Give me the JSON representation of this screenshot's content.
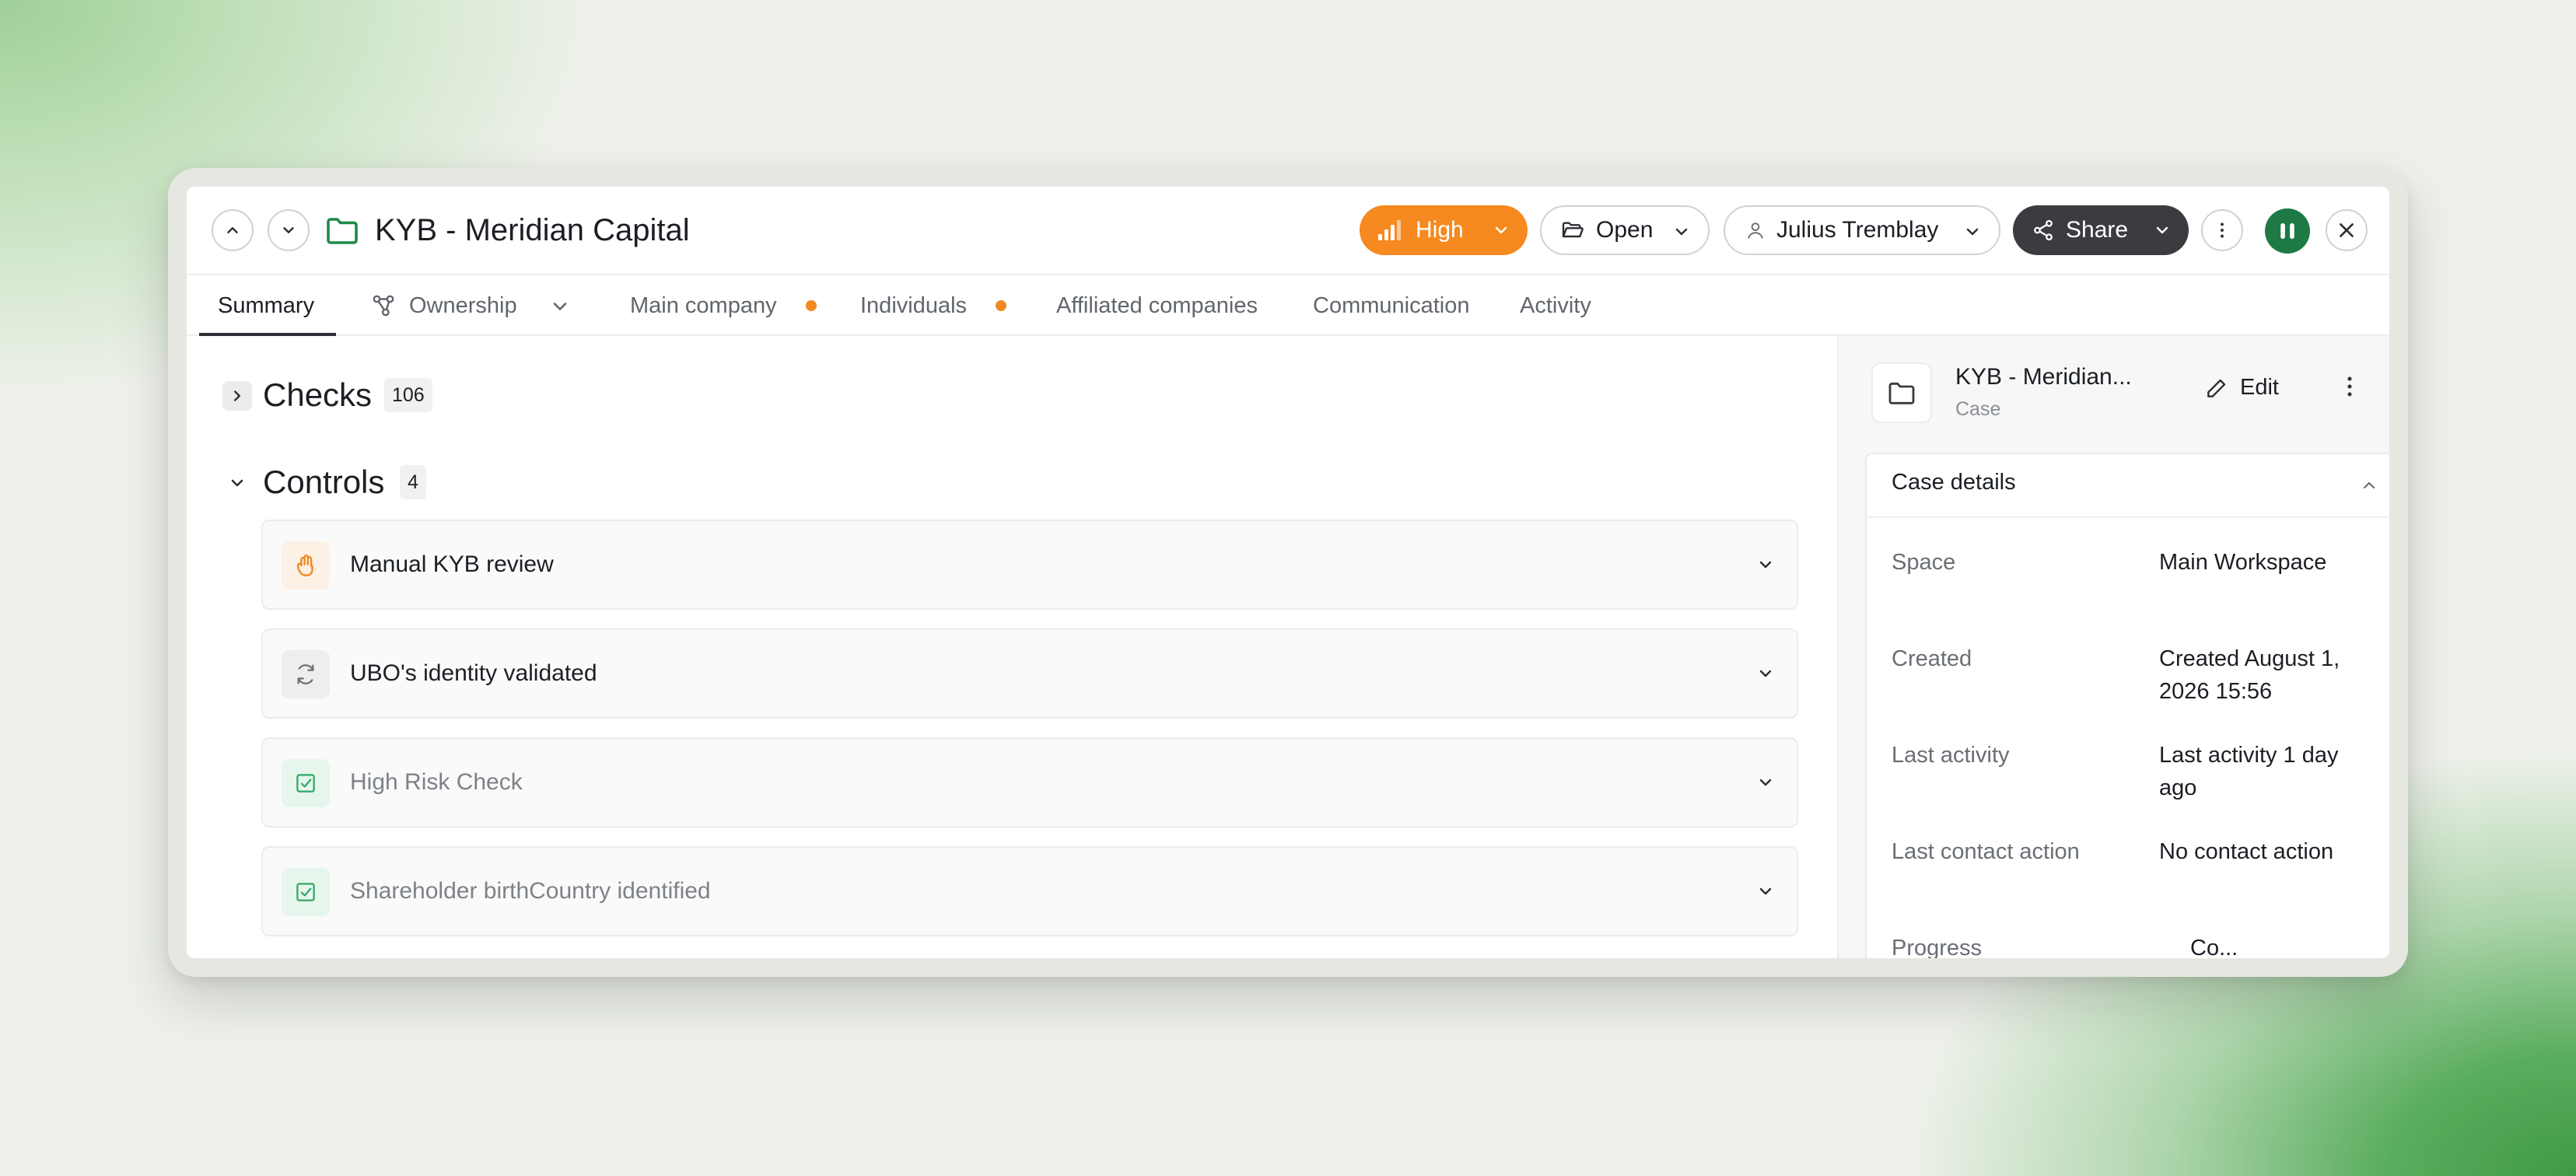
{
  "header": {
    "title": "KYB - Meridian Capital",
    "priority_label": "High",
    "status_label": "Open",
    "assignee_label": "Julius Tremblay",
    "share_label": "Share",
    "priority_color": "#f6891f",
    "avatar_color": "#1e7a45"
  },
  "tabs": [
    {
      "label": "Summary",
      "active": true
    },
    {
      "label": "Ownership",
      "icon": "network-icon"
    },
    {
      "label": "Main company",
      "has_dot": true
    },
    {
      "label": "Individuals",
      "has_dot": true
    },
    {
      "label": "Affiliated companies"
    },
    {
      "label": "Communication"
    },
    {
      "label": "Activity"
    }
  ],
  "main": {
    "checks": {
      "title": "Checks",
      "count": "106",
      "expanded": false
    },
    "controls": {
      "title": "Controls",
      "count": "4",
      "expanded": true,
      "items": [
        {
          "label": "Manual KYB review",
          "icon": "hand-icon",
          "muted": false
        },
        {
          "label": "UBO's identity validated",
          "icon": "refresh-icon",
          "muted": false
        },
        {
          "label": "High Risk Check",
          "icon": "checkbox-icon",
          "muted": true
        },
        {
          "label": "Shareholder birthCountry identified",
          "icon": "checkbox-icon",
          "muted": true
        }
      ]
    }
  },
  "sidebar": {
    "case_name": "KYB - Meridian...",
    "case_type": "Case",
    "edit_label": "Edit",
    "details": {
      "title": "Case details",
      "rows": [
        {
          "key": "Space",
          "value": "Main Workspace"
        },
        {
          "key": "Created",
          "value": "Created August 1, 2026 15:56"
        },
        {
          "key": "Last activity",
          "value": "Last activity 1 day ago"
        },
        {
          "key": "Last contact action",
          "value": "No contact action"
        },
        {
          "key": "Progress",
          "value": "Co..."
        }
      ]
    }
  }
}
